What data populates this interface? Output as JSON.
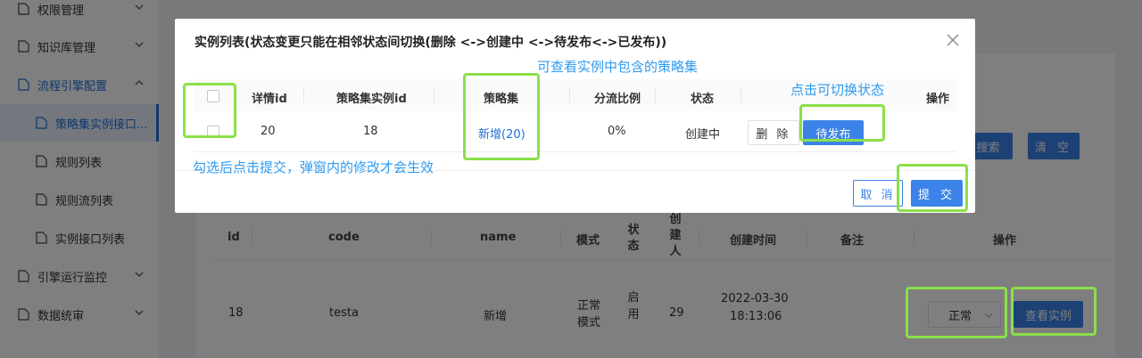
{
  "sidebar": {
    "items": [
      {
        "label": "权限管理"
      },
      {
        "label": "知识库管理"
      },
      {
        "label": "流程引擎配置"
      },
      {
        "label": "策略集实例接口..."
      },
      {
        "label": "规则列表"
      },
      {
        "label": "规则流列表"
      },
      {
        "label": "实例接口列表"
      },
      {
        "label": "引擎运行监控"
      },
      {
        "label": "数据统审"
      }
    ]
  },
  "main": {
    "search_label": "搜索",
    "clear_label": "清 空",
    "table": {
      "headers": [
        "id",
        "code",
        "name",
        "模式",
        "状态",
        "创建人",
        "创建时间",
        "备注",
        "操作"
      ],
      "rows": [
        {
          "id": "18",
          "code": "testa",
          "name": "新增",
          "mode": "正常模式",
          "status": "启用",
          "creator": "29",
          "created_date": "2022-03-30",
          "created_time": "18:13:06",
          "note": ""
        }
      ]
    },
    "select_value": "正常",
    "view_instance_label": "查看实例"
  },
  "dialog": {
    "title": "实例列表(状态变更只能在相邻状态间切换(删除 <->创建中 <->待发布<->已发布))",
    "headers": [
      "详情id",
      "策略集实例id",
      "策略集",
      "分流比例",
      "状态",
      "操作"
    ],
    "row": {
      "detail_id": "20",
      "instance_id": "18",
      "strategy": "新增(20)",
      "ratio": "0%",
      "status": "创建中",
      "delete_label": "删 除",
      "publish_label": "待发布"
    },
    "cancel_label": "取 消",
    "submit_label": "提 交"
  },
  "annotations": {
    "strategy_hint": "可查看实例中包含的策略集",
    "switch_hint": "点击可切换状态",
    "submit_hint": "勾选后点击提交，弹窗内的修改才会生效"
  },
  "colors": {
    "accent": "#3b83e8",
    "annotation_box": "#8ae04a",
    "annotation_text": "#2f9bf0"
  }
}
